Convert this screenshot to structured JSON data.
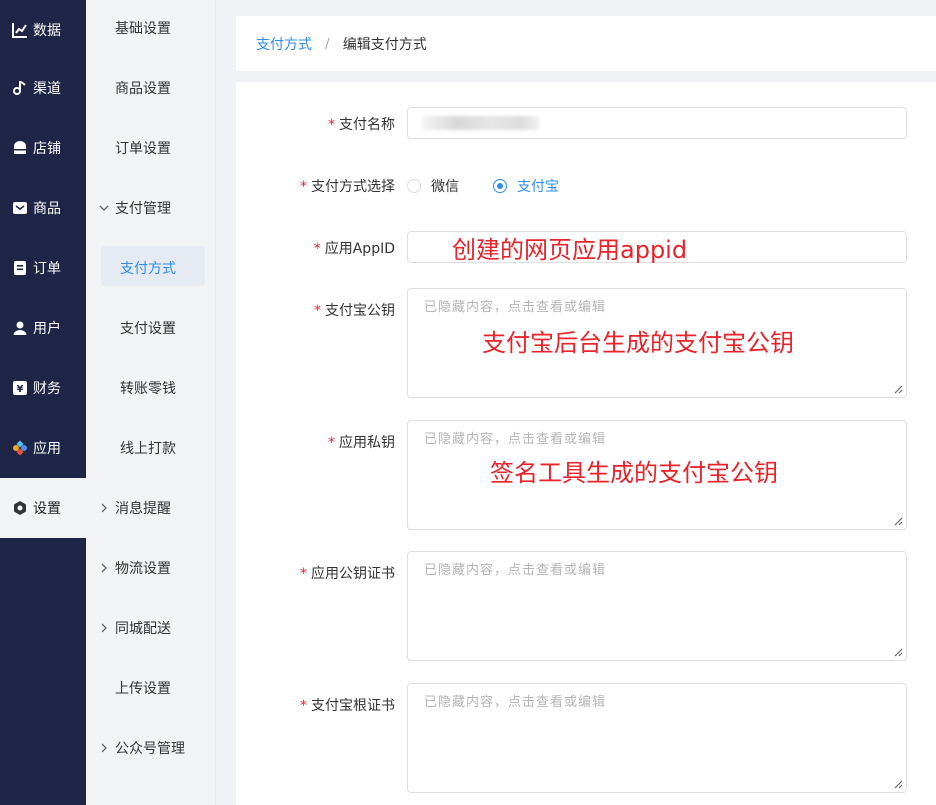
{
  "nav": {
    "items": [
      {
        "label": "数据",
        "icon": "chart-line-icon"
      },
      {
        "label": "渠道",
        "icon": "channel-icon"
      },
      {
        "label": "店铺",
        "icon": "store-icon"
      },
      {
        "label": "商品",
        "icon": "product-icon"
      },
      {
        "label": "订单",
        "icon": "order-icon"
      },
      {
        "label": "用户",
        "icon": "user-icon"
      },
      {
        "label": "财务",
        "icon": "finance-icon"
      },
      {
        "label": "应用",
        "icon": "apps-icon"
      },
      {
        "label": "设置",
        "icon": "gear-icon"
      }
    ],
    "active": "设置"
  },
  "submenu": {
    "items": [
      {
        "label": "基础设置"
      },
      {
        "label": "商品设置"
      },
      {
        "label": "订单设置"
      },
      {
        "label": "支付管理"
      },
      {
        "label": "支付方式"
      },
      {
        "label": "支付设置"
      },
      {
        "label": "转账零钱"
      },
      {
        "label": "线上打款"
      },
      {
        "label": "消息提醒"
      },
      {
        "label": "物流设置"
      },
      {
        "label": "同城配送"
      },
      {
        "label": "上传设置"
      },
      {
        "label": "公众号管理"
      }
    ],
    "selected": "支付方式"
  },
  "breadcrumb": {
    "parent": "支付方式",
    "separator": "/",
    "current": "编辑支付方式"
  },
  "form": {
    "name_label": "支付名称",
    "method_label": "支付方式选择",
    "method_options": [
      "微信",
      "支付宝"
    ],
    "method_selected": "支付宝",
    "appid_label": "应用AppID",
    "alipay_pubkey_label": "支付宝公钥",
    "app_privkey_label": "应用私钥",
    "app_pubcert_label": "应用公钥证书",
    "alipay_rootcert_label": "支付宝根证书",
    "hidden_placeholder": "已隐藏内容，点击查看或编辑"
  },
  "annotations": {
    "appid": "创建的网页应用appid",
    "alipay_pubkey": "支付宝后台生成的支付宝公钥",
    "app_privkey": "签名工具生成的支付宝公钥"
  },
  "colors": {
    "nav_bg": "#1f2547",
    "accent": "#2d8cf0",
    "required": "#f5222d",
    "annotation": "#e8232a"
  }
}
